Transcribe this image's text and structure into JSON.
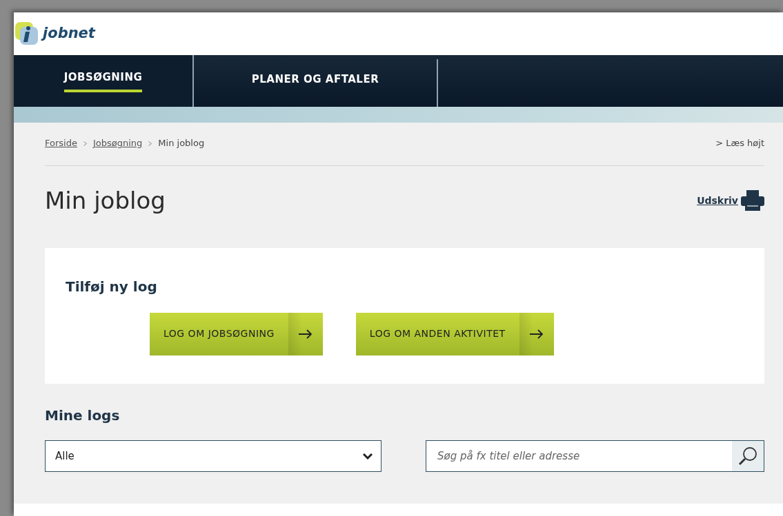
{
  "logo": {
    "text": "jobnet"
  },
  "tabs": [
    {
      "label": "JOBSØGNING",
      "selected": true
    },
    {
      "label": "PLANER OG AFTALER",
      "selected": false
    }
  ],
  "breadcrumb": [
    {
      "label": "Forside",
      "link": true
    },
    {
      "label": "Jobsøgning",
      "link": true
    },
    {
      "label": "Min joblog",
      "link": false
    }
  ],
  "read_aloud": "> Læs højt",
  "page_title": "Min joblog",
  "print_link": "Udskriv",
  "add_log": {
    "heading": "Tilføj ny log",
    "buttons": [
      "LOG OM JOBSØGNING",
      "LOG OM ANDEN AKTIVITET"
    ]
  },
  "my_logs": {
    "heading": "Mine logs",
    "filter": {
      "value": "Alle"
    },
    "search": {
      "placeholder": "Søg på fx titel eller adresse"
    }
  }
}
